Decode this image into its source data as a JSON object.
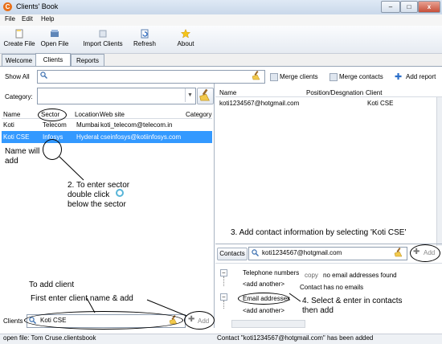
{
  "window": {
    "title": "Clients' Book",
    "app_icon": "C"
  },
  "window_controls": {
    "minimize": "–",
    "maximize": "□",
    "close": "x"
  },
  "menu": [
    "File",
    "Edit",
    "Help"
  ],
  "toolbar": [
    {
      "label": "Create File",
      "icon": "new-file-icon"
    },
    {
      "label": "Open File",
      "icon": "open-file-icon"
    },
    {
      "label": "Import Clients",
      "icon": "import-icon"
    },
    {
      "label": "Refresh",
      "icon": "refresh-icon"
    },
    {
      "label": "About",
      "icon": "star-icon"
    }
  ],
  "tabs": [
    {
      "label": "Welcome",
      "active": false
    },
    {
      "label": "Clients",
      "active": true
    },
    {
      "label": "Reports",
      "active": false
    }
  ],
  "search": {
    "show_all_label": "Show All",
    "value": ""
  },
  "actions": {
    "merge_clients": "Merge clients",
    "merge_contacts": "Merge contacts",
    "add_report": "Add report"
  },
  "category": {
    "label": "Category:",
    "value": ""
  },
  "clients_table": {
    "columns": [
      "Name",
      "Sector",
      "Location",
      "Web site",
      "Category"
    ],
    "rows": [
      {
        "name": "Koti",
        "sector": "Telecom",
        "location": "Mumbai",
        "website": "koti_telecom@telecom.in",
        "category": "",
        "selected": false
      },
      {
        "name": "Koti CSE",
        "sector": "Infosys",
        "location": "Hyderabad",
        "website": "cseinfosys@kotiinfosys.com",
        "category": "",
        "selected": true
      }
    ]
  },
  "contacts_table": {
    "columns": [
      "Name",
      "Position/Desgnation",
      "Client"
    ],
    "rows": [
      {
        "name": "koti1234567@hotgmail.com",
        "position": "",
        "client": "Koti CSE"
      }
    ]
  },
  "contacts_bar": {
    "label": "Contacts",
    "value": "koti1234567@hotgmail.com",
    "add_label": "Add"
  },
  "details": {
    "tree": [
      {
        "label": "Telephone numbers",
        "child": "<add another>"
      },
      {
        "label": "Email addresses",
        "child": "<add another>"
      }
    ],
    "copy_label": "copy",
    "no_email_msg": "no email addresses found",
    "has_no_emails": "Contact has no emails"
  },
  "clients_bar": {
    "label": "Clients",
    "value": "Koti CSE",
    "add_label": "Add"
  },
  "status": {
    "left": "open file: Tom Cruse.clientsbook",
    "right": "Contact \"koti1234567@hotgmail.com\" has been added"
  },
  "annotations": {
    "name_will_add": "Name will\nadd",
    "enter_sector": "2. To enter sector\ndouble click\nbelow the sector",
    "add_contact": "3. Add contact information by selecting 'Koti CSE'",
    "select_enter": "4. Select & enter in contacts\nthen add",
    "to_add_client": "To add client",
    "first_enter": "First enter client name & add"
  },
  "colors": {
    "selection": "#3399ff",
    "accent_orange": "#e8701a"
  }
}
